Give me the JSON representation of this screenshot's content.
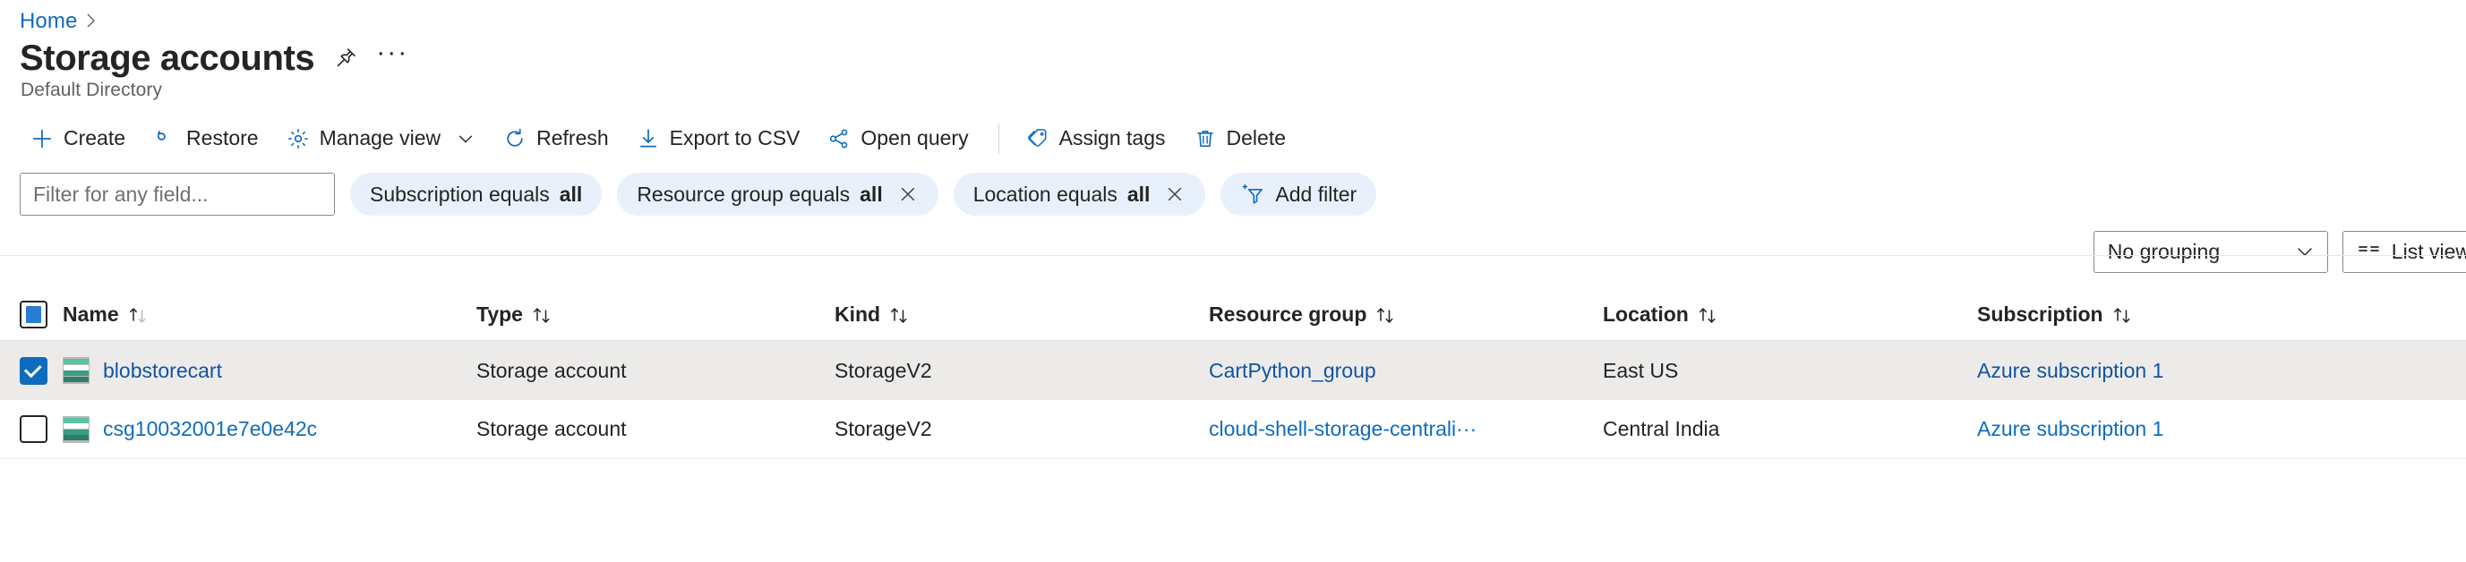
{
  "breadcrumb": {
    "home": "Home",
    "separator": "›"
  },
  "header": {
    "title": "Storage accounts",
    "subtitle": "Default Directory",
    "pin_icon": "pin-icon",
    "more_label": "···"
  },
  "commandbar": {
    "items": [
      {
        "label": "Create",
        "icon": "plus-icon"
      },
      {
        "label": "Restore",
        "icon": "restore-icon"
      },
      {
        "label": "Manage view",
        "icon": "gear-icon",
        "chevron": true
      },
      {
        "label": "Refresh",
        "icon": "refresh-icon"
      },
      {
        "label": "Export to CSV",
        "icon": "download-icon"
      },
      {
        "label": "Open query",
        "icon": "open-query-icon"
      },
      {
        "label": "Assign tags",
        "icon": "tags-icon"
      },
      {
        "label": "Delete",
        "icon": "trash-icon"
      }
    ]
  },
  "filters": {
    "search_placeholder": "Filter for any field...",
    "search_value": "",
    "pills": [
      {
        "label": "Subscription equals ",
        "value": "all",
        "removable": false
      },
      {
        "label": "Resource group equals ",
        "value": "all",
        "removable": true
      },
      {
        "label": "Location equals ",
        "value": "all",
        "removable": true
      }
    ],
    "add_filter_label": "Add filter",
    "add_filter_icon": "add-filter-icon"
  },
  "grouping": {
    "selected": "No grouping",
    "chevron_icon": "chevron-down-icon",
    "view_label": "List view",
    "view_icon": "list-view-icon"
  },
  "table": {
    "columns": [
      {
        "label": "Name"
      },
      {
        "label": "Type"
      },
      {
        "label": "Kind"
      },
      {
        "label": "Resource group"
      },
      {
        "label": "Location"
      },
      {
        "label": "Subscription"
      }
    ],
    "sort_icon": "sort-arrows-icon",
    "header_checkbox_state": "indeterminate",
    "rows": [
      {
        "selected": true,
        "name": "blobstorecart",
        "icon": "storage-account-icon",
        "type": "Storage account",
        "kind": "StorageV2",
        "resource_group": "CartPython_group",
        "location": "East US",
        "subscription": "Azure subscription 1"
      },
      {
        "selected": false,
        "name": "csg10032001e7e0e42c",
        "icon": "storage-account-icon",
        "type": "Storage account",
        "kind": "StorageV2",
        "resource_group": "cloud-shell-storage-centrali···",
        "location": "Central India",
        "subscription": "Azure subscription 1"
      }
    ]
  },
  "colors": {
    "link": "#0f6cbd",
    "accent": "#0f6cbd",
    "pill_bg": "#e8f1fb",
    "selected_row": "#edebe9"
  }
}
